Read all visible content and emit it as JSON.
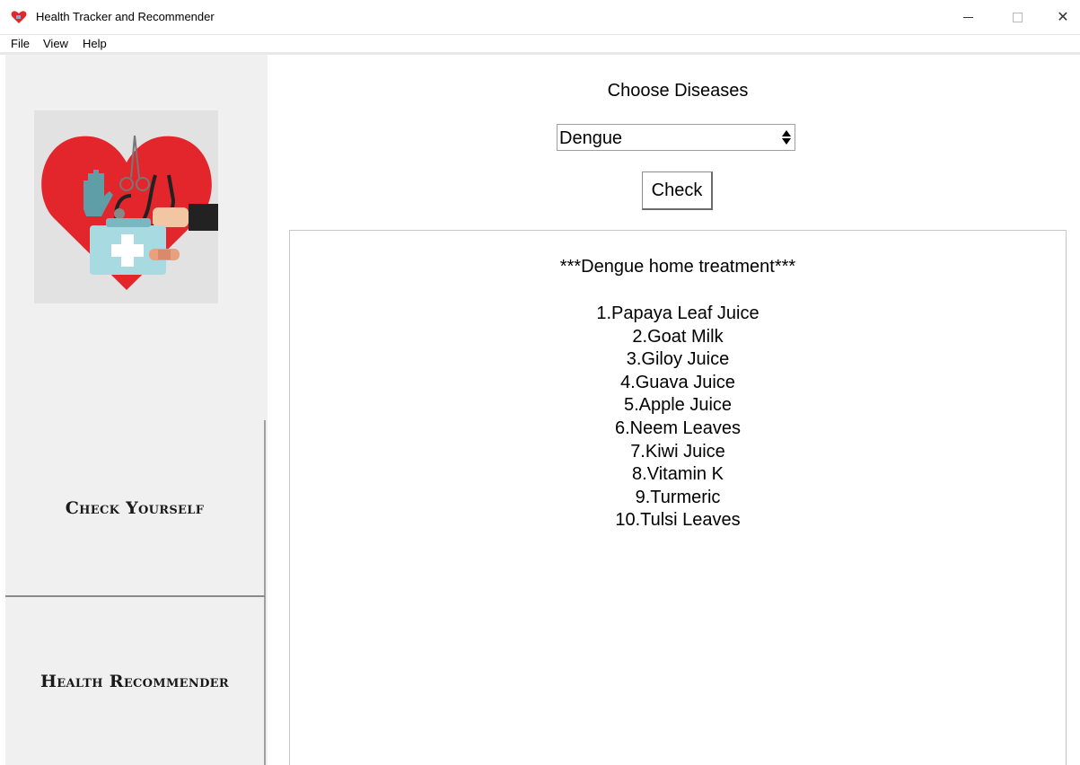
{
  "window": {
    "title": "Health Tracker and Recommender",
    "controls": {
      "minimize": "minimize",
      "maximize": "maximize",
      "close": "✕"
    }
  },
  "menu": [
    "File",
    "View",
    "Help"
  ],
  "sidebar": {
    "logo_icon": "heart-medical-kit-icon",
    "buttons": [
      "Check Yourself",
      "Health Recommender"
    ]
  },
  "main": {
    "choose_label": "Choose Diseases",
    "selected_disease": "Dengue",
    "check_button": "Check",
    "result_title": "***Dengue home treatment***",
    "treatments": [
      "1.Papaya Leaf Juice",
      "2.Goat Milk",
      "3.Giloy Juice",
      "4.Guava Juice",
      "5.Apple Juice",
      "6.Neem Leaves",
      "7.Kiwi Juice",
      "8.Vitamin K",
      "9.Turmeric",
      "10.Tulsi Leaves"
    ]
  },
  "colors": {
    "heart": "#e3262c",
    "sidebar_bg": "#f0f0f0",
    "logo_bg": "#e2e2e2"
  }
}
